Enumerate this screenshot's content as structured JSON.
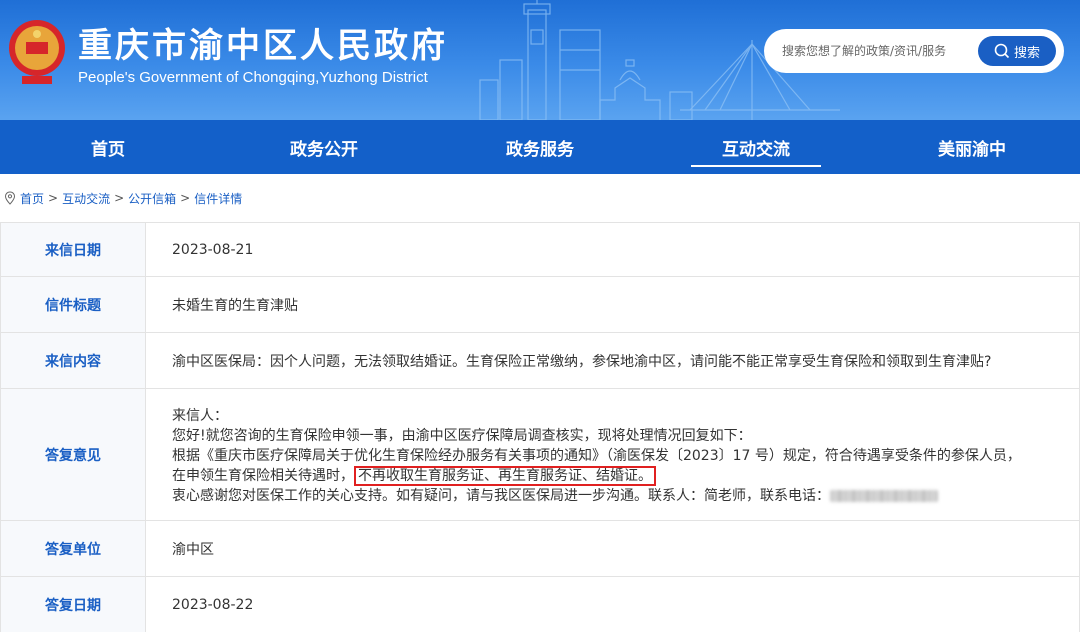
{
  "header": {
    "title": "重庆市渝中区人民政府",
    "subtitle": "People's Government of Chongqing,Yuzhong District"
  },
  "search": {
    "placeholder": "搜索您想了解的政策/资讯/服务",
    "button_label": "搜索"
  },
  "nav": {
    "items": [
      {
        "label": "首页"
      },
      {
        "label": "政务公开"
      },
      {
        "label": "政务服务"
      },
      {
        "label": "互动交流",
        "active": true
      },
      {
        "label": "美丽渝中"
      }
    ]
  },
  "breadcrumb": {
    "items": [
      "首页",
      "互动交流",
      "公开信箱",
      "信件详情"
    ],
    "separator": ">"
  },
  "letter": {
    "date_label": "来信日期",
    "date_value": "2023-08-21",
    "title_label": "信件标题",
    "title_value": "未婚生育的生育津贴",
    "content_label": "来信内容",
    "content_value": "渝中区医保局：因个人问题，无法领取结婚证。生育保险正常缴纳，参保地渝中区，请问能不能正常享受生育保险和领取到生育津贴?",
    "reply_label": "答复意见",
    "reply_line1": "来信人：",
    "reply_line2": "您好!就您咨询的生育保险申领一事，由渝中区医疗保障局调查核实，现将处理情况回复如下：",
    "reply_line3": "根据《重庆市医疗保障局关于优化生育保险经办服务有关事项的通知》（渝医保发〔2023〕17 号）规定，符合待遇享受条件的参保人员，",
    "reply_line4_prefix": "在申领生育保险相关待遇时，",
    "reply_line4_highlight": "不再收取生育服务证、再生育服务证、结婚证。",
    "reply_line5": "衷心感谢您对医保工作的关心支持。如有疑问，请与我区医保局进一步沟通。联系人：简老师，联系电话：",
    "unit_label": "答复单位",
    "unit_value": "渝中区",
    "reply_date_label": "答复日期",
    "reply_date_value": "2023-08-22"
  },
  "colors": {
    "brand_blue": "#1360c9",
    "label_blue": "#1a5fc4",
    "highlight_red": "#e02020"
  }
}
